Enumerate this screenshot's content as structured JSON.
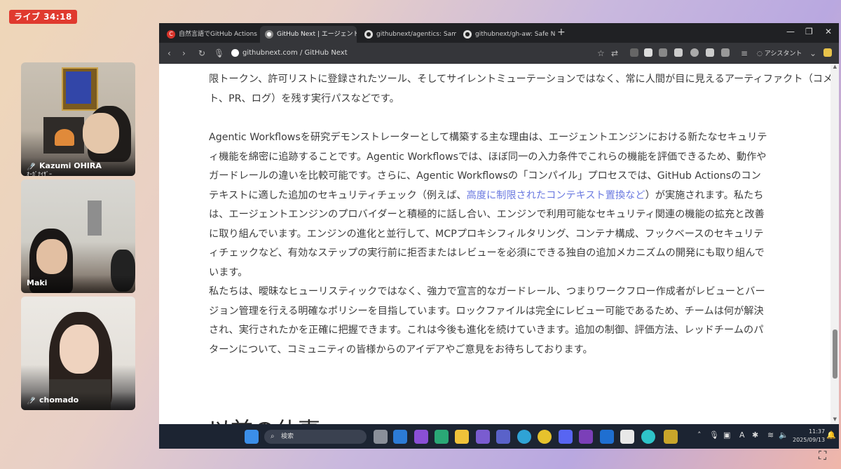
{
  "live": {
    "label": "ライブ 34:18"
  },
  "participants": [
    {
      "name": "Kazumi OHIRA",
      "role": "ｵｰｶﾞﾅｲｻﾞｰ"
    },
    {
      "name": "Maki"
    },
    {
      "name": "chomado"
    }
  ],
  "browser": {
    "tabs": [
      {
        "label": "自然言語でGitHub Actionsを"
      },
      {
        "label": "GitHub Next | エージェント型ワー"
      },
      {
        "label": "githubnext/agentics: Sample"
      },
      {
        "label": "githubnext/gh-aw: Safe Natur"
      }
    ],
    "url": "githubnext.com / GitHub Next",
    "assistant_label": "アシスタント"
  },
  "article": {
    "para0_line1": "限トークン、許可リストに登録されたツール、そしてサイレントミューテーションではなく、常に人間が目に見えるアーティファクト（コメン",
    "para0_line2": "ト、PR、ログ）を残す実行パスなどです。",
    "para1_a": "Agentic Workflowsを研究デモンストレーターとして構築する主な理由は、エージェントエンジンにおける新たなセキュリティ機能を綿密に追跡することです。Agentic Workflowsでは、ほぼ同一の入力条件でこれらの機能を評価できるため、動作やガードレールの違いを比較可能です。さらに、Agentic Workflowsの「コンパイル」プロセスでは、GitHub Actionsのコンテキストに適した追加のセキュリティチェック（例えば、",
    "para1_link": "高度に制限されたコンテキスト置換など",
    "para1_b": "）が実施されます。私たちは、エージェントエンジンのプロバイダーと積極的に話し合い、エンジンで利用可能なセキュリティ関連の機能の拡充と改善に取り組んでいます。エンジンの進化と並行して、MCPプロキシフィルタリング、コンテナ構成、フックベースのセキュリティチェックなど、有効なステップの実行前に拒否またはレビューを必須にできる独自の追加メカニズムの開発にも取り組んでいます。",
    "para2": "私たちは、曖昧なヒューリスティックではなく、強力で宣言的なガードレール、つまりワークフロー作成者がレビューとバージョン管理を行える明確なポリシーを目指しています。ロックファイルは完全にレビュー可能であるため、チームは何が解決され、実行されたかを正確に把握できます。これは今後も進化を続けていきます。追加の制御、評価方法、レッドチームのパターンについて、コミュニティの皆様からのアイデアやご意見をお待ちしております。",
    "heading_partial": "以前の仕事"
  },
  "taskbar": {
    "search_placeholder": "検索",
    "time": "11:37",
    "date": "2025/09/13",
    "ime": "A"
  }
}
